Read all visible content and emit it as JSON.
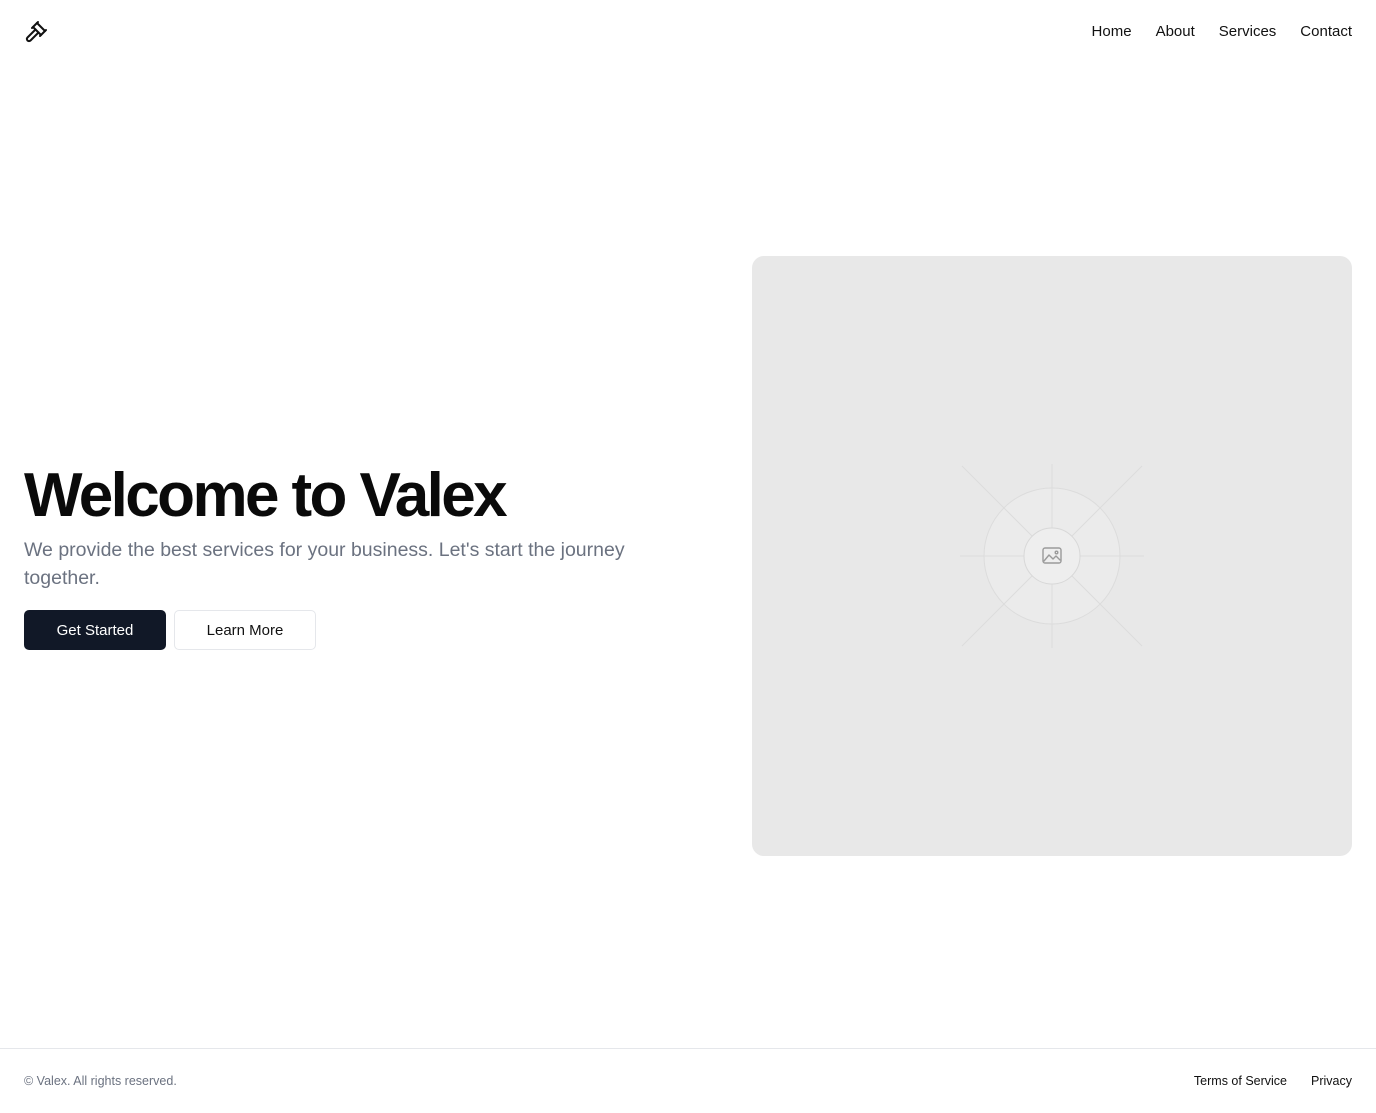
{
  "header": {
    "logo_icon": "gavel-icon",
    "nav": [
      {
        "label": "Home"
      },
      {
        "label": "About"
      },
      {
        "label": "Services"
      },
      {
        "label": "Contact"
      }
    ]
  },
  "hero": {
    "title": "Welcome to Valex",
    "subtitle": "We provide the best services for your business. Let's start the journey together.",
    "primary_button": "Get Started",
    "secondary_button": "Learn More",
    "image_icon": "image-placeholder-icon"
  },
  "footer": {
    "copyright": "© Valex. All rights reserved.",
    "links": [
      {
        "label": "Terms of Service"
      },
      {
        "label": "Privacy"
      }
    ]
  },
  "colors": {
    "primary_button_bg": "#111827",
    "subtitle_text": "#6b7280",
    "image_placeholder_bg": "#e8e8e8"
  }
}
